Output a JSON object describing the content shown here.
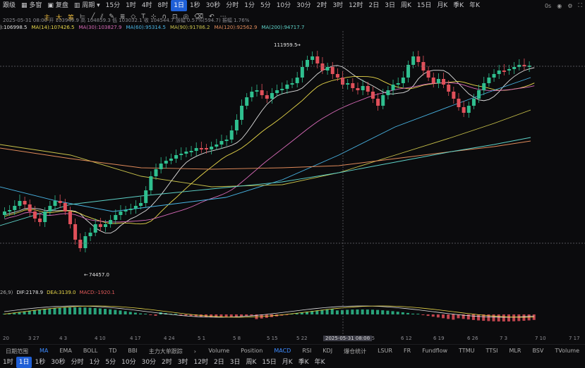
{
  "topbar": {
    "left_labels": [
      "跟级",
      "多窗",
      "复盘",
      "周期"
    ],
    "periods": [
      "15分",
      "1时",
      "4时",
      "8时",
      "1日",
      "1秒",
      "30秒",
      "分时",
      "1分",
      "5分",
      "10分",
      "30分",
      "2时",
      "3时",
      "12时",
      "2日",
      "3日",
      "周K",
      "15日",
      "月K",
      "季K",
      "年K"
    ],
    "active_period": "1日",
    "tools": [
      "主",
      "大",
      "筹"
    ],
    "right": [
      "0s"
    ]
  },
  "info_line": "2025-05-31 08:00  开 103949.9  高 104859.3  低 103032.1  收 104544.7  涨幅 0.57%(594.7)  振幅 1.76%",
  "ma_line": [
    {
      "text": "):106998.5",
      "color": "#e0e0e0"
    },
    {
      "text": "MA(14):107426.5",
      "color": "#e9d84a"
    },
    {
      "text": "MA(30):103827.9",
      "color": "#d86ab8"
    },
    {
      "text": "MA(60):95314.5",
      "color": "#49b6e6"
    },
    {
      "text": "MA(90):91786.2",
      "color": "#c9c24a"
    },
    {
      "text": "MA(120):92562.9",
      "color": "#e08a5a"
    },
    {
      "text": "MA(200):94717.7",
      "color": "#5ed2c8"
    }
  ],
  "annotations": {
    "high": "111959.5",
    "low": "74457.0"
  },
  "macd_line": [
    {
      "text": "26,9)",
      "color": "#aaa"
    },
    {
      "text": "DIF:2178.9",
      "color": "#e0e0e0"
    },
    {
      "text": "DEA:3139.0",
      "color": "#e9d84a"
    },
    {
      "text": "MACD:-1920.1",
      "color": "#e05a5a"
    }
  ],
  "dates": [
    "20",
    "3 27",
    "4 3",
    "4 10",
    "4 17",
    "4 24",
    "5 1",
    "5 8",
    "5 15",
    "5 22",
    "2025-05-31 08:00",
    "6 5",
    "6 12",
    "6 19",
    "6 26",
    "7 3",
    "7 10",
    "7 17"
  ],
  "indicator_tabs": {
    "left": [
      "日期范围",
      "MA",
      "EMA",
      "BOLL",
      "TD",
      "BBI",
      "主力大单跟踪"
    ],
    "right": [
      "Volume",
      "Position",
      "MACD",
      "RSI",
      "KDJ",
      "爆仓统计",
      "LSUR",
      "FR",
      "Fundflow",
      "TTMU",
      "TTSI",
      "MLR",
      "BSV",
      "TVolume"
    ],
    "active_left": "MA",
    "active_right": "MACD"
  },
  "bottom_periods": [
    "1时",
    "1日",
    "1秒",
    "30秒",
    "分时",
    "1分",
    "5分",
    "10分",
    "30分",
    "2时",
    "3时",
    "12时",
    "2日",
    "3日",
    "周K",
    "15日",
    "月K",
    "季K",
    "年K"
  ],
  "bottom_active": "1日",
  "colors": {
    "up": "#2fbf8f",
    "down": "#e0505a",
    "accent": "#1f5fd6"
  }
}
